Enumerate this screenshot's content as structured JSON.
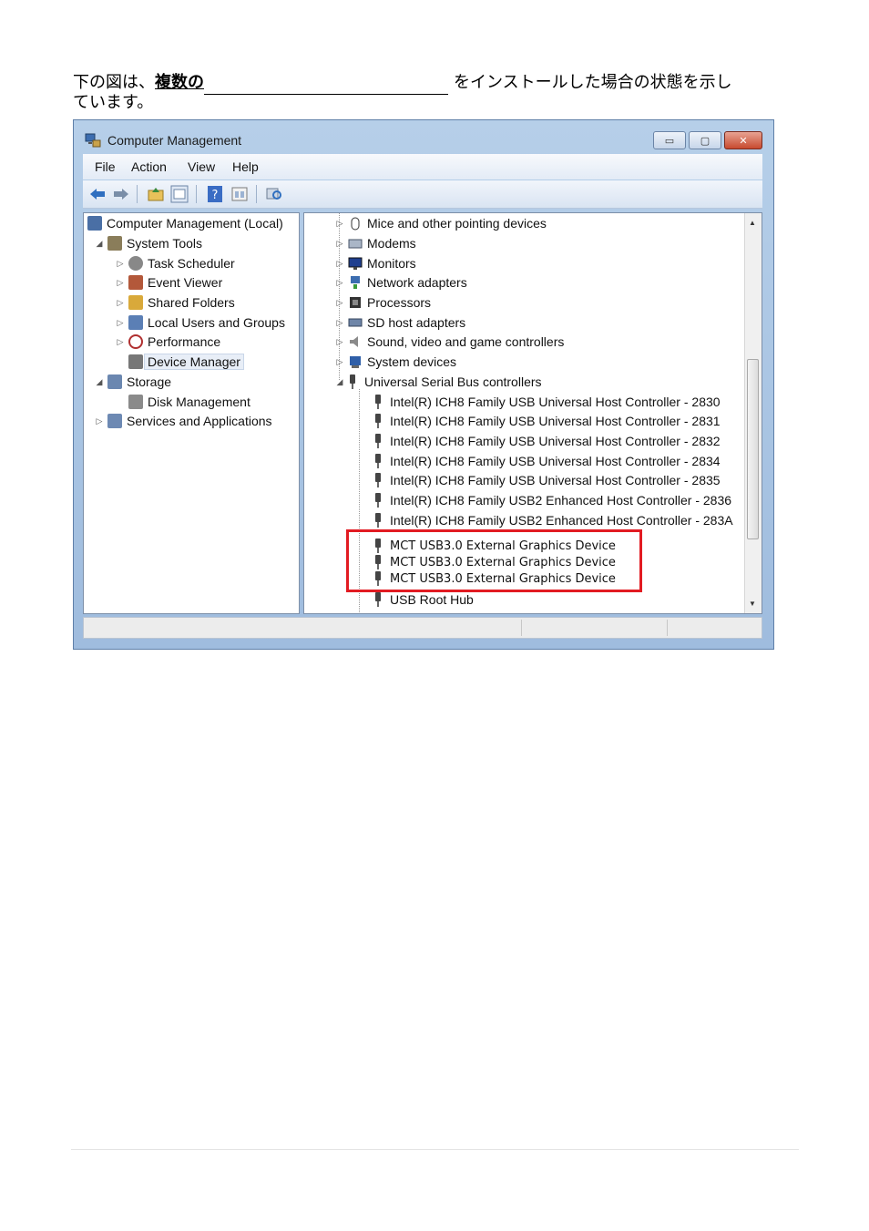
{
  "intro": {
    "prefix": "下の図は、",
    "bold": "複数の",
    "suffix": "をインストールした場合の状態を示し",
    "line2": "ています。"
  },
  "window": {
    "title": "Computer Management",
    "menu": [
      "File",
      "Action",
      "View",
      "Help"
    ],
    "buttons": {
      "minimize": "▭",
      "maximize": "▢",
      "close": "✕"
    }
  },
  "left_tree": [
    {
      "label": "Computer Management (Local)",
      "icon": "computer-management-icon",
      "color": "#4a6fa5"
    },
    {
      "label": "System Tools",
      "icon": "system-tools-icon",
      "color": "#8a7d5a"
    },
    {
      "label": "Task Scheduler",
      "icon": "clock-icon",
      "color": "#888888"
    },
    {
      "label": "Event Viewer",
      "icon": "event-viewer-icon",
      "color": "#b3583a"
    },
    {
      "label": "Shared Folders",
      "icon": "shared-folders-icon",
      "color": "#d9a93a"
    },
    {
      "label": "Local Users and Groups",
      "icon": "users-icon",
      "color": "#5b7fb5"
    },
    {
      "label": "Performance",
      "icon": "performance-icon",
      "color": "#b03030"
    },
    {
      "label": "Device Manager",
      "icon": "device-manager-icon",
      "color": "#777777"
    },
    {
      "label": "Storage",
      "icon": "storage-icon",
      "color": "#6b87b0"
    },
    {
      "label": "Disk Management",
      "icon": "disk-icon",
      "color": "#8a8a8a"
    },
    {
      "label": "Services and Applications",
      "icon": "services-icon",
      "color": "#6d89b3"
    }
  ],
  "right_tree": [
    {
      "label": "Mice and other pointing devices",
      "icon": "mouse-icon"
    },
    {
      "label": "Modems",
      "icon": "modem-icon"
    },
    {
      "label": "Monitors",
      "icon": "monitor-icon"
    },
    {
      "label": "Network adapters",
      "icon": "network-icon"
    },
    {
      "label": "Processors",
      "icon": "processor-icon"
    },
    {
      "label": "SD host adapters",
      "icon": "sd-card-icon"
    },
    {
      "label": "Sound, video and game controllers",
      "icon": "sound-icon"
    },
    {
      "label": "System devices",
      "icon": "system-devices-icon"
    },
    {
      "label": "Universal Serial Bus controllers",
      "icon": "usb-icon"
    }
  ],
  "usb_children": [
    "Intel(R) ICH8 Family USB Universal Host Controller - 2830",
    "Intel(R) ICH8 Family USB Universal Host Controller - 2831",
    "Intel(R) ICH8 Family USB Universal Host Controller - 2832",
    "Intel(R) ICH8 Family USB Universal Host Controller - 2834",
    "Intel(R) ICH8 Family USB Universal Host Controller - 2835",
    "Intel(R) ICH8 Family USB2 Enhanced Host Controller - 2836",
    "Intel(R) ICH8 Family USB2 Enhanced Host Controller - 283A"
  ],
  "mct_devices": [
    "MCT USB3.0 External Graphics Device",
    "MCT USB3.0 External Graphics Device",
    "MCT USB3.0 External Graphics Device"
  ],
  "last_item": "USB Root Hub",
  "highlight_color": "#e21b22"
}
